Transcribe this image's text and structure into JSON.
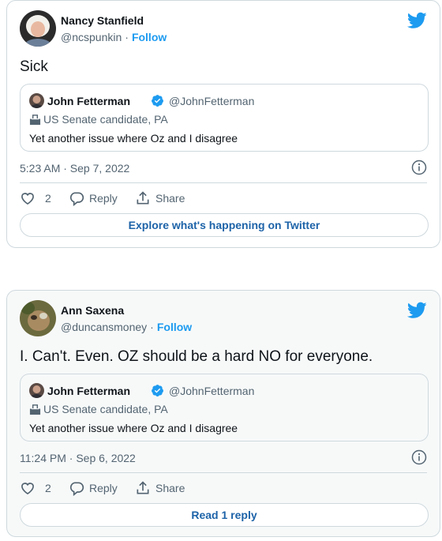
{
  "colors": {
    "accent": "#1d9bf0",
    "text": "#0f1419",
    "muted": "#536471",
    "border": "#cfd9de"
  },
  "tweets": [
    {
      "author": {
        "name": "Nancy Stanfield",
        "handle": "@ncspunkin",
        "separator": "·",
        "follow_label": "Follow",
        "avatar_icon": "avatar-woman-white-hair"
      },
      "text": "Sick",
      "quoted": {
        "name": "John Fetterman",
        "handle": "@JohnFetterman",
        "verified_icon": "verified-badge-icon",
        "label": "US Senate candidate, PA",
        "text": "Yet another issue where Oz and I disagree"
      },
      "timestamp": "5:23 AM · Sep 7, 2022",
      "likes": "2",
      "reply_label": "Reply",
      "share_label": "Share",
      "cta": "Explore what's happening on Twitter"
    },
    {
      "author": {
        "name": "Ann Saxena",
        "handle": "@duncansmoney",
        "separator": "·",
        "follow_label": "Follow",
        "avatar_icon": "avatar-dog"
      },
      "text": "I. Can't. Even. OZ should be a hard NO for everyone.",
      "quoted": {
        "name": "John Fetterman",
        "handle": "@JohnFetterman",
        "verified_icon": "verified-badge-icon",
        "label": "US Senate candidate, PA",
        "text": "Yet another issue where Oz and I disagree"
      },
      "timestamp": "11:24 PM · Sep 6, 2022",
      "likes": "2",
      "reply_label": "Reply",
      "share_label": "Share",
      "cta": "Read 1 reply"
    }
  ]
}
